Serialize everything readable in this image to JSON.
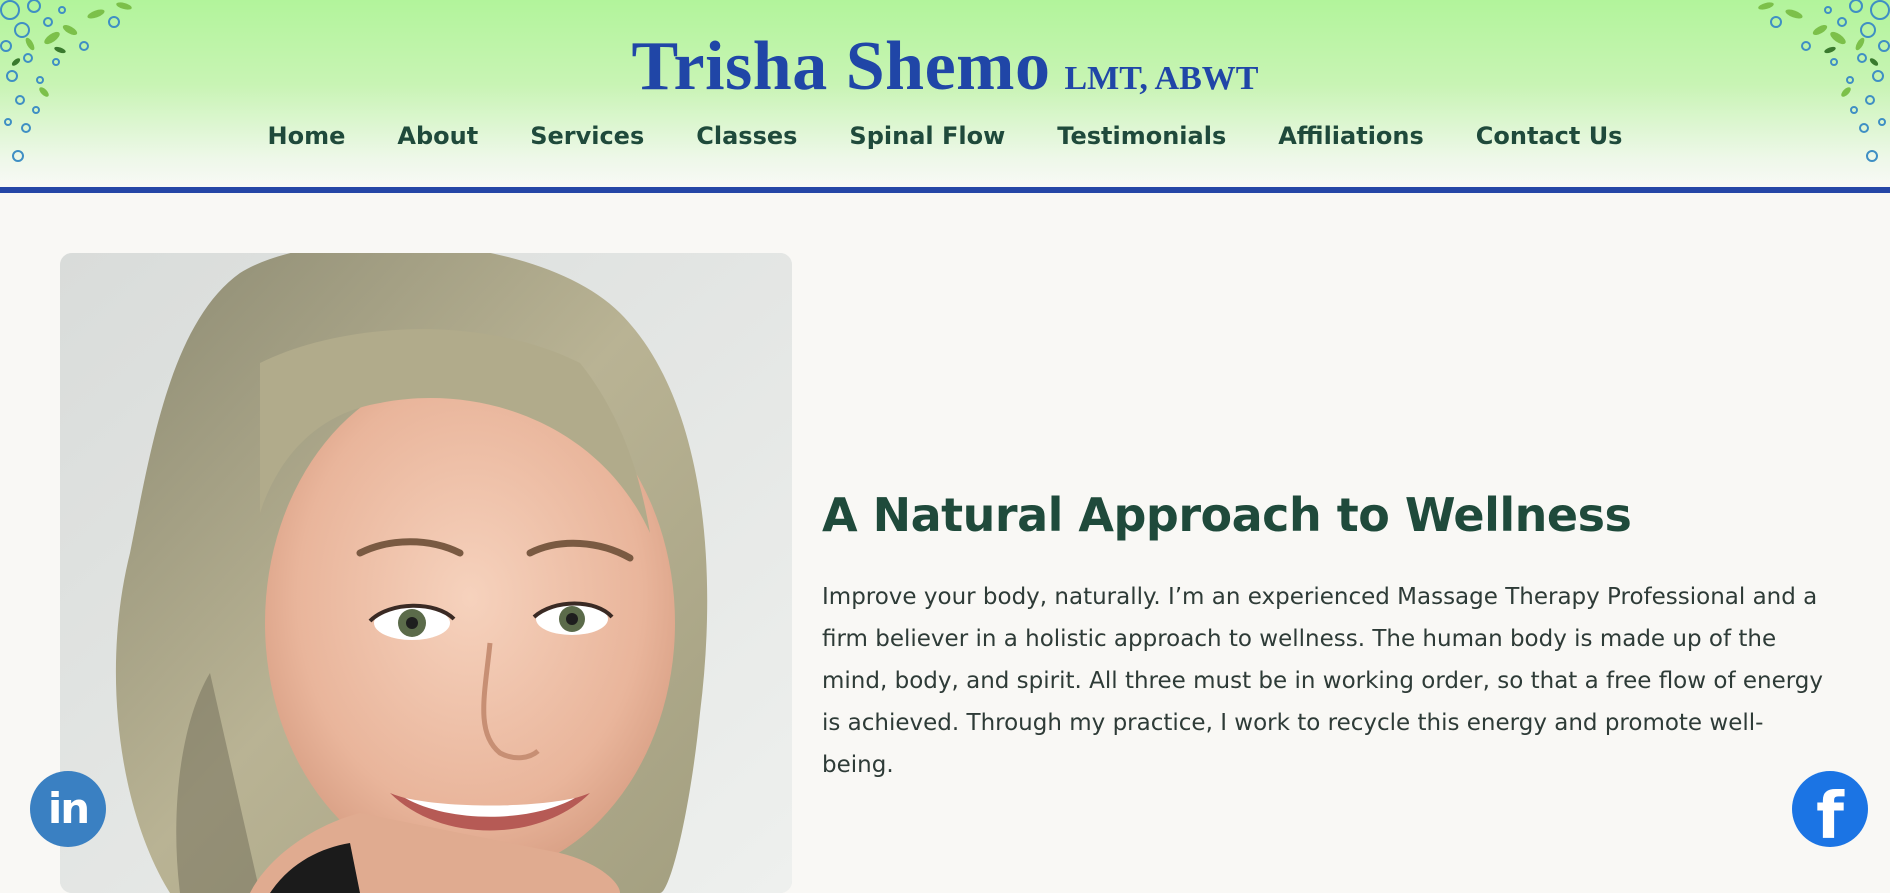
{
  "site": {
    "name": "Trisha Shemo",
    "credentials": "LMT, ABWT"
  },
  "nav": {
    "items": [
      {
        "label": "Home"
      },
      {
        "label": "About"
      },
      {
        "label": "Services"
      },
      {
        "label": "Classes"
      },
      {
        "label": "Spinal Flow"
      },
      {
        "label": "Testimonials"
      },
      {
        "label": "Affiliations"
      },
      {
        "label": "Contact Us"
      }
    ]
  },
  "hero": {
    "heading": "A Natural Approach to Wellness",
    "body": "Improve your body, naturally. I’m an experienced Massage Therapy Professional and a firm believer in a holistic approach to wellness. The human body is made up of the mind, body, and spirit. All three must be in working order, so that a free flow of energy is achieved. Through my practice, I work to recycle this energy and promote well-being."
  },
  "social": {
    "linkedin_glyph": "in",
    "facebook_glyph": "f",
    "linkedin_icon": "linkedin-icon",
    "facebook_icon": "facebook-icon"
  },
  "colors": {
    "brand_blue": "#2046a7",
    "nav_green": "#1f4a3b",
    "header_green": "#b2f49b",
    "divider_blue": "#2546a6",
    "linkedin_blue": "#3a80c2",
    "facebook_blue": "#1b74e4"
  }
}
